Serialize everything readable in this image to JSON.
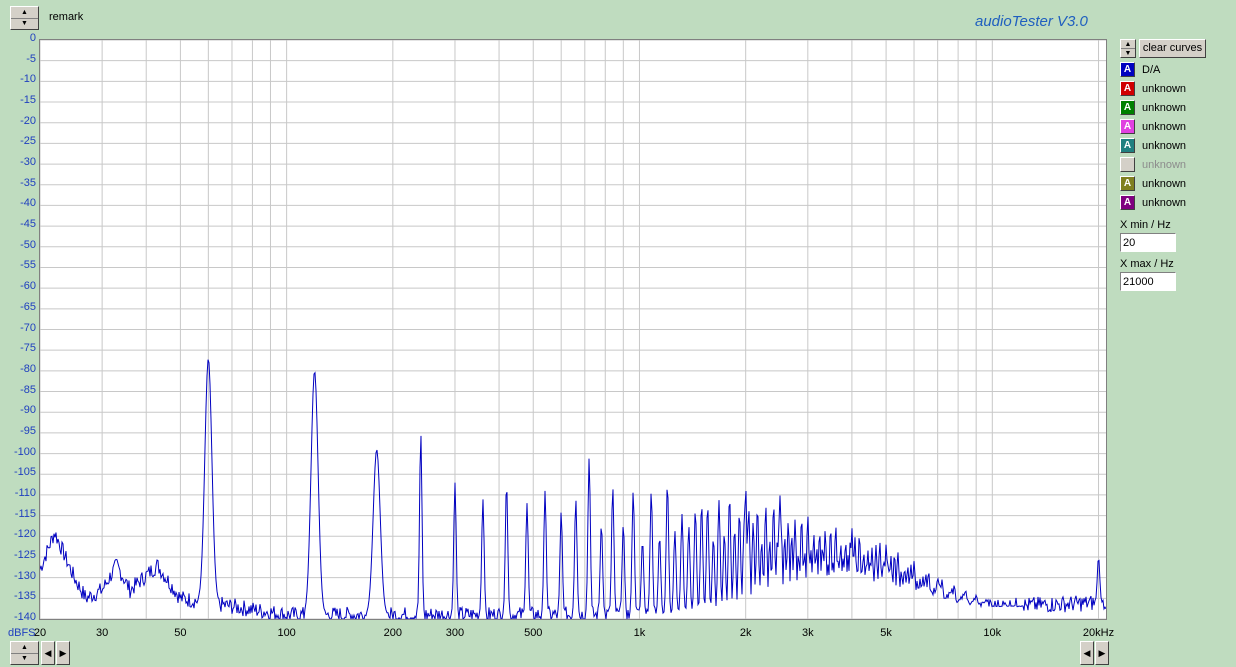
{
  "header": {
    "remark": "remark",
    "brand": "audioTester  V3.0",
    "top_spinner": {
      "up": "▲",
      "down": "▼"
    }
  },
  "plot": {
    "unit_label": "dBFS",
    "y_ticks": [
      "0",
      "-5",
      "-10",
      "-15",
      "-20",
      "-25",
      "-30",
      "-35",
      "-40",
      "-45",
      "-50",
      "-55",
      "-60",
      "-65",
      "-70",
      "-75",
      "-80",
      "-85",
      "-90",
      "-95",
      "-100",
      "-105",
      "-110",
      "-115",
      "-120",
      "-125",
      "-130",
      "-135",
      "-140"
    ],
    "x_ticks": [
      {
        "label": "20",
        "hz": 20
      },
      {
        "label": "30",
        "hz": 30
      },
      {
        "label": "50",
        "hz": 50
      },
      {
        "label": "100",
        "hz": 100
      },
      {
        "label": "200",
        "hz": 200
      },
      {
        "label": "300",
        "hz": 300
      },
      {
        "label": "500",
        "hz": 500
      },
      {
        "label": "1k",
        "hz": 1000
      },
      {
        "label": "2k",
        "hz": 2000
      },
      {
        "label": "3k",
        "hz": 3000
      },
      {
        "label": "5k",
        "hz": 5000
      },
      {
        "label": "10k",
        "hz": 10000
      },
      {
        "label": "20kHz",
        "hz": 20000
      }
    ]
  },
  "chart_data": {
    "type": "line",
    "x_scale": "log",
    "xlim": [
      20,
      21000
    ],
    "ylim": [
      -140,
      0
    ],
    "grid": true,
    "series": [
      {
        "name": "D/A",
        "color": "#0000c0",
        "peaks": [
          {
            "x": 60,
            "y": -77
          },
          {
            "x": 120,
            "y": -80
          },
          {
            "x": 180,
            "y": -99
          },
          {
            "x": 240,
            "y": -95
          },
          {
            "x": 300,
            "y": -107
          },
          {
            "x": 360,
            "y": -111
          },
          {
            "x": 420,
            "y": -107
          },
          {
            "x": 480,
            "y": -112
          },
          {
            "x": 540,
            "y": -109
          },
          {
            "x": 600,
            "y": -114
          },
          {
            "x": 660,
            "y": -111
          },
          {
            "x": 720,
            "y": -101
          },
          {
            "x": 780,
            "y": -117
          },
          {
            "x": 840,
            "y": -108
          },
          {
            "x": 900,
            "y": -117
          },
          {
            "x": 960,
            "y": -109
          },
          {
            "x": 1080,
            "y": -109
          },
          {
            "x": 1200,
            "y": -107
          },
          {
            "x": 1500,
            "y": -112
          },
          {
            "x": 2000,
            "y": -108
          },
          {
            "x": 2500,
            "y": -110
          },
          {
            "x": 3000,
            "y": -115
          },
          {
            "x": 4000,
            "y": -118
          },
          {
            "x": 5000,
            "y": -122
          },
          {
            "x": 6000,
            "y": -126
          },
          {
            "x": 7000,
            "y": -130
          },
          {
            "x": 20000,
            "y": -125
          }
        ],
        "floor": [
          {
            "x": 20,
            "y": -128
          },
          {
            "x": 22,
            "y": -119
          },
          {
            "x": 25,
            "y": -130
          },
          {
            "x": 27,
            "y": -135
          },
          {
            "x": 30,
            "y": -133
          },
          {
            "x": 33,
            "y": -127
          },
          {
            "x": 36,
            "y": -133
          },
          {
            "x": 43,
            "y": -127
          },
          {
            "x": 50,
            "y": -135
          },
          {
            "x": 100,
            "y": -139
          },
          {
            "x": 1000,
            "y": -139
          },
          {
            "x": 10000,
            "y": -137
          },
          {
            "x": 21000,
            "y": -136
          }
        ]
      }
    ]
  },
  "legend": {
    "clear_label": "clear curves",
    "channel_glyph": "A",
    "channels": [
      {
        "label": "D/A",
        "color": "#0000c0",
        "enabled": true
      },
      {
        "label": "unknown",
        "color": "#d00000",
        "enabled": true
      },
      {
        "label": "unknown",
        "color": "#008000",
        "enabled": true
      },
      {
        "label": "unknown",
        "color": "#e040e0",
        "enabled": true
      },
      {
        "label": "unknown",
        "color": "#208080",
        "enabled": true
      },
      {
        "label": "unknown",
        "color": "#c0c0c0",
        "enabled": false
      },
      {
        "label": "unknown",
        "color": "#808020",
        "enabled": true
      },
      {
        "label": "unknown",
        "color": "#800080",
        "enabled": true
      }
    ]
  },
  "xrange": {
    "min_label": "X min / Hz",
    "min_value": "20",
    "max_label": "X max / Hz",
    "max_value": "21000"
  },
  "footer": {
    "left_arrow": "◀",
    "right_arrow": "▶"
  }
}
